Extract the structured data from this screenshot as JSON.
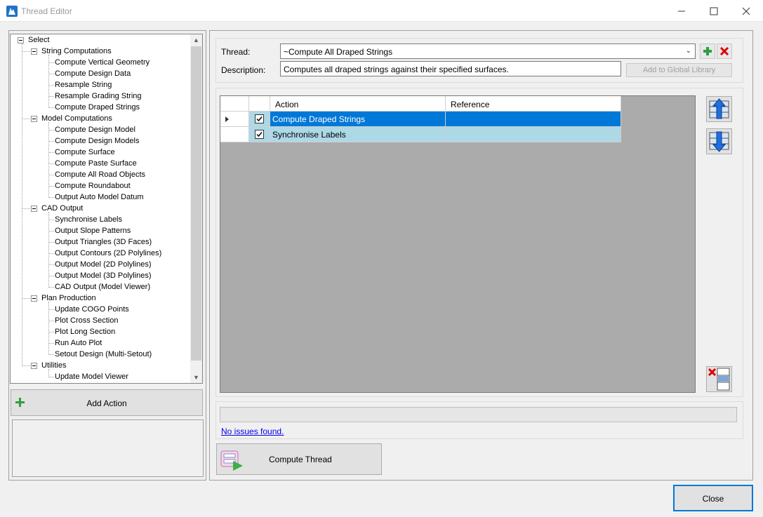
{
  "window": {
    "title": "Thread Editor"
  },
  "tree": {
    "root": "Select",
    "groups": [
      {
        "label": "String Computations",
        "items": [
          "Compute Vertical Geometry",
          "Compute Design Data",
          "Resample String",
          "Resample Grading String",
          "Compute Draped Strings"
        ]
      },
      {
        "label": "Model Computations",
        "items": [
          "Compute Design Model",
          "Compute Design Models",
          "Compute Surface",
          "Compute Paste Surface",
          "Compute All Road Objects",
          "Compute Roundabout",
          "Output Auto Model Datum"
        ]
      },
      {
        "label": "CAD Output",
        "items": [
          "Synchronise Labels",
          "Output Slope Patterns",
          "Output Triangles (3D Faces)",
          "Output Contours (2D Polylines)",
          "Output Model (2D Polylines)",
          "Output Model (3D Polylines)",
          "CAD Output (Model Viewer)"
        ]
      },
      {
        "label": "Plan Production",
        "items": [
          "Update COGO Points",
          "Plot Cross Section",
          "Plot Long Section",
          "Run Auto Plot",
          "Setout Design (Multi-Setout)"
        ]
      },
      {
        "label": "Utilities",
        "items": [
          "Update Model Viewer"
        ]
      }
    ]
  },
  "left": {
    "add_action_label": "Add Action"
  },
  "thread": {
    "label": "Thread:",
    "value": "~Compute All Draped Strings",
    "description_label": "Description:",
    "description": "Computes all draped strings against their specified surfaces.",
    "add_global_label": "Add to Global Library"
  },
  "grid": {
    "columns": [
      "Action",
      "Reference"
    ],
    "rows": [
      {
        "action": "Compute Draped Strings",
        "reference": "",
        "checked": true,
        "selected": true
      },
      {
        "action": "Synchronise Labels",
        "reference": "",
        "checked": true,
        "selected": false
      }
    ]
  },
  "status": {
    "issues_text": "No issues found."
  },
  "buttons": {
    "compute_thread": "Compute Thread",
    "close": "Close"
  },
  "colors": {
    "selected_row": "#0078d7",
    "row_highlight": "#add8e6",
    "accent": "#0078d7"
  }
}
